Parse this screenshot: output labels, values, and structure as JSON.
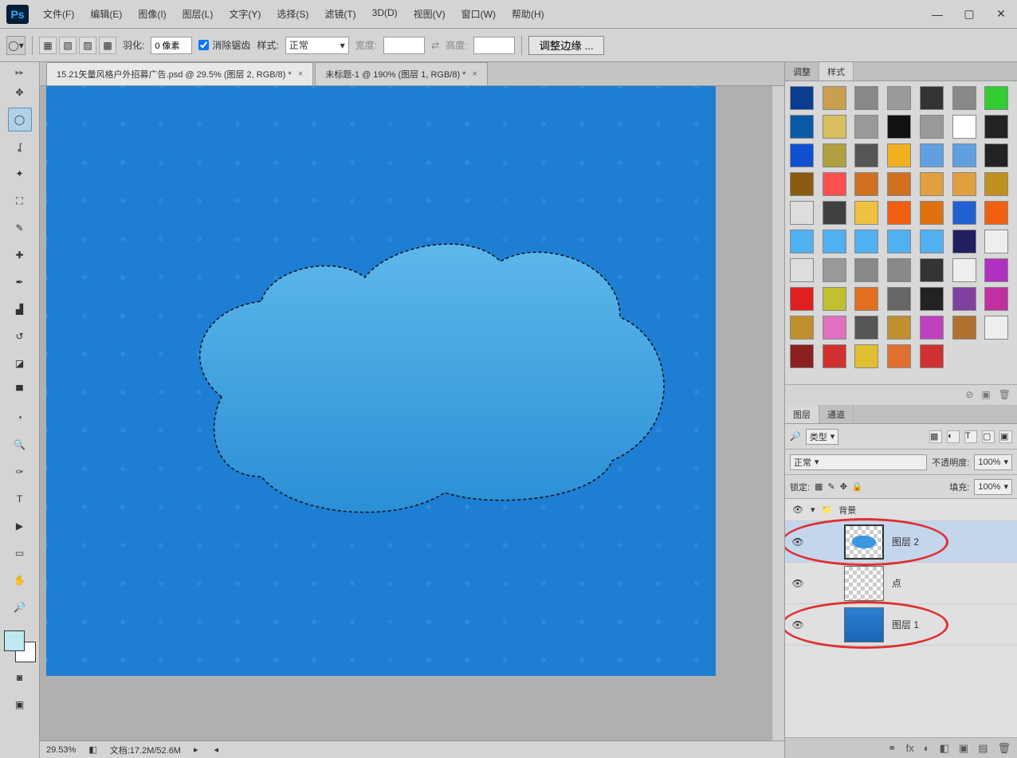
{
  "titlebar": {
    "logo": "Ps"
  },
  "menu": [
    "文件(F)",
    "编辑(E)",
    "图像(I)",
    "图层(L)",
    "文字(Y)",
    "选择(S)",
    "滤镜(T)",
    "3D(D)",
    "视图(V)",
    "窗口(W)",
    "帮助(H)"
  ],
  "optionbar": {
    "feather_label": "羽化:",
    "feather_value": "0 像素",
    "antialias": "消除锯齿",
    "style_label": "样式:",
    "style_value": "正常",
    "width_label": "宽度:",
    "width_value": "",
    "height_label": "高度:",
    "height_value": "",
    "refine_edge": "调整边缘 ..."
  },
  "tabs": [
    {
      "label": "15.21矢量风格户外招募广告.psd @ 29.5% (图层 2, RGB/8) *",
      "active": true
    },
    {
      "label": "未标题-1 @ 190% (图层 1, RGB/8) *",
      "active": false
    }
  ],
  "statusbar": {
    "zoom": "29.53%",
    "doc": "文档:17.2M/52.6M"
  },
  "styles_panel": {
    "tabs": [
      "调整",
      "样式"
    ],
    "active_tab": 1,
    "swatches": [
      "#0a3d91",
      "#c8a050",
      "#888",
      "#9a9a9a",
      "#333",
      "#888",
      "#3c3",
      "#0a59a6",
      "#d8c060",
      "#999",
      "#111",
      "#999",
      "#fff",
      "#222",
      "#1050d0",
      "#b0a040",
      "#555",
      "#f0b020",
      "#60a0e0",
      "#60a0e0",
      "#222",
      "#8a5a10",
      "#ff5050",
      "#d07020",
      "#d07020",
      "#e0a040",
      "#e0a040",
      "#c09020",
      "#ddd",
      "#404040",
      "#f0c040",
      "#f06010",
      "#e07010",
      "#2060d0",
      "#f06010",
      "#50b0f0",
      "#50b0f0",
      "#50b0f0",
      "#50b0f0",
      "#50b0f0",
      "#202060",
      "#eee",
      "#ddd",
      "#999",
      "#888",
      "#888",
      "#333",
      "#eee",
      "#b030c0",
      "#e02020",
      "#c0c030",
      "#e07020",
      "#666",
      "#222",
      "#8040a0",
      "#c030a0",
      "#c09030",
      "#e070c0",
      "#555",
      "#c09030",
      "#c040c0",
      "#b07030",
      "#eee",
      "#8a2020",
      "#d03030",
      "#e0c030",
      "#e07030",
      "#d03030"
    ]
  },
  "layers_panel": {
    "tabs": [
      "图层",
      "通道"
    ],
    "active_tab": 0,
    "filter_label": "类型",
    "blend_mode": "正常",
    "opacity_label": "不透明度:",
    "opacity_value": "100%",
    "lock_label": "锁定:",
    "fill_label": "填充:",
    "fill_value": "100%",
    "group": "背景",
    "layers": [
      {
        "name": "图层 2",
        "selected": true,
        "thumb": "cloud"
      },
      {
        "name": "点",
        "selected": false,
        "thumb": "transparent"
      },
      {
        "name": "图层 1",
        "selected": false,
        "thumb": "blue"
      }
    ]
  },
  "footer_icons": [
    "⚭",
    "fx",
    "◐",
    "◧",
    "▣",
    "▤",
    "🗑"
  ]
}
